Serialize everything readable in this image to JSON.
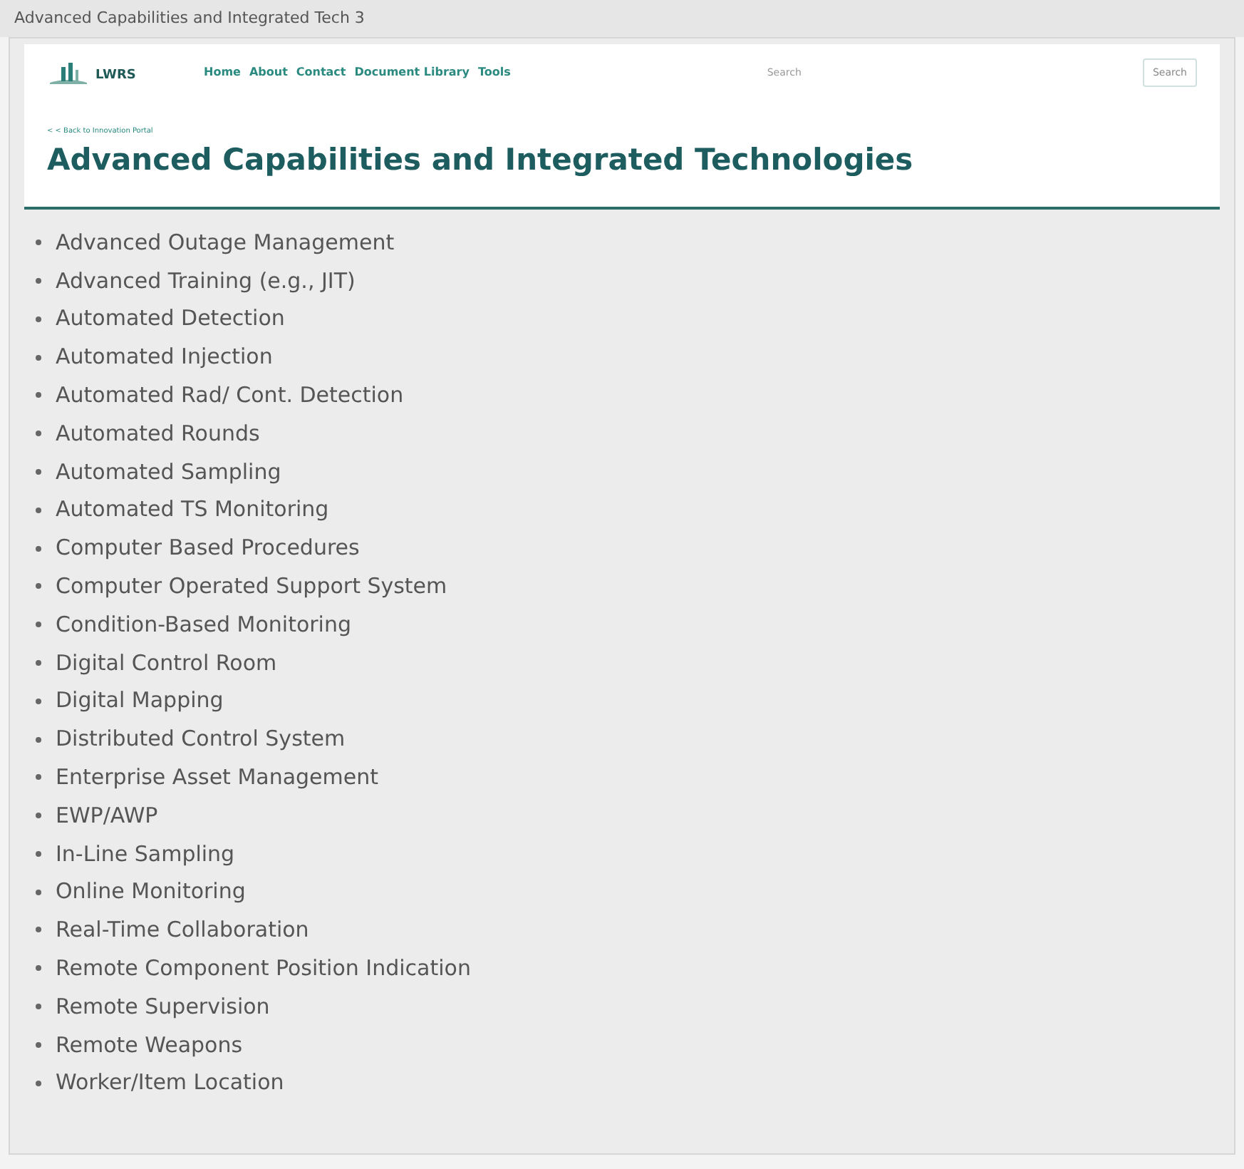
{
  "window": {
    "title": "Advanced Capabilities and Integrated Tech 3"
  },
  "header": {
    "logo": "LWRS",
    "nav": [
      "Home",
      "About",
      "Contact",
      "Document Library",
      "Tools"
    ],
    "search": {
      "placeholder": "Search"
    },
    "search_button": "Search"
  },
  "back_link": "< < Back to Innovation Portal",
  "page_title": "Advanced Capabilities and Integrated Technologies",
  "items": [
    "Advanced Outage Management",
    "Advanced Training (e.g., JIT)",
    "Automated Detection",
    "Automated Injection",
    "Automated Rad/ Cont. Detection",
    "Automated Rounds",
    "Automated Sampling",
    "Automated TS Monitoring",
    "Computer Based Procedures",
    "Computer Operated Support System",
    "Condition-Based Monitoring",
    "Digital Control Room",
    "Digital Mapping",
    "Distributed Control System",
    "Enterprise Asset Management",
    "EWP/AWP",
    "In-Line Sampling",
    "Online Monitoring",
    "Real-Time Collaboration",
    "Remote Component Position Indication",
    "Remote Supervision",
    "Remote Weapons",
    "Worker/Item Location"
  ]
}
